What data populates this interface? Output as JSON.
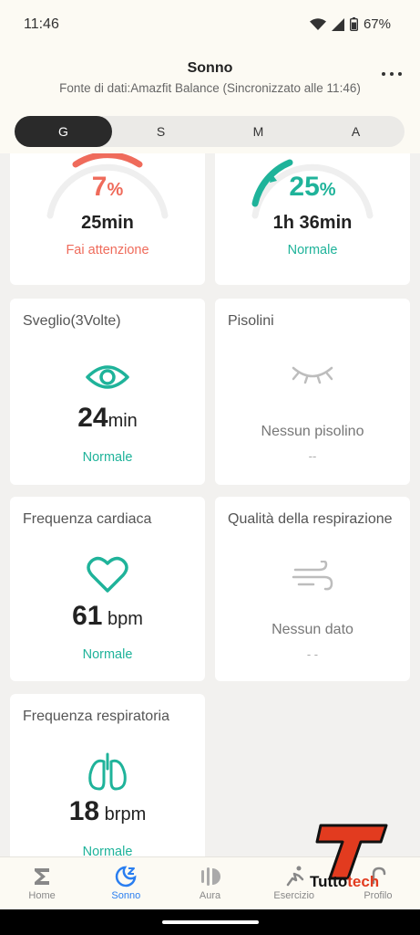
{
  "status_bar": {
    "time": "11:46",
    "battery": "67%"
  },
  "header": {
    "title": "Sonno",
    "subtitle": "Fonte di dati:Amazfit Balance (Sincronizzato alle 11:46)"
  },
  "segments": [
    "G",
    "S",
    "M",
    "A"
  ],
  "cards": {
    "deep": {
      "percent": "7",
      "percent_unit": "%",
      "value": "25min",
      "status": "Fai attenzione",
      "progress_fraction": 0.07
    },
    "rem": {
      "percent": "25",
      "percent_unit": "%",
      "value": "1h 36min",
      "status": "Normale",
      "progress_fraction": 0.25
    },
    "awake": {
      "title": "Sveglio(3Volte)",
      "value": "24",
      "unit": "min",
      "status": "Normale"
    },
    "naps": {
      "title": "Pisolini",
      "text": "Nessun pisolino",
      "dash": "--"
    },
    "heart": {
      "title": "Frequenza cardiaca",
      "value": "61",
      "unit": " bpm",
      "status": "Normale"
    },
    "breath_quality": {
      "title": "Qualità della respirazione",
      "text": "Nessun dato",
      "dash": "- -"
    },
    "resp_rate": {
      "title": "Frequenza respiratoria",
      "value": "18",
      "unit": " brpm",
      "status": "Normale"
    }
  },
  "bottom_nav": [
    {
      "label": "Home",
      "icon": "sigma-icon"
    },
    {
      "label": "Sonno",
      "icon": "sleep-icon"
    },
    {
      "label": "Aura",
      "icon": "aura-icon"
    },
    {
      "label": "Esercizio",
      "icon": "exercise-icon"
    },
    {
      "label": "Profilo",
      "icon": "profile-icon"
    }
  ],
  "watermark": {
    "part1": "Tutto",
    "part2": "tech"
  },
  "colors": {
    "accent_green": "#1fb39a",
    "warn_red": "#ef6b5b",
    "nav_active": "#2a7ef0"
  }
}
